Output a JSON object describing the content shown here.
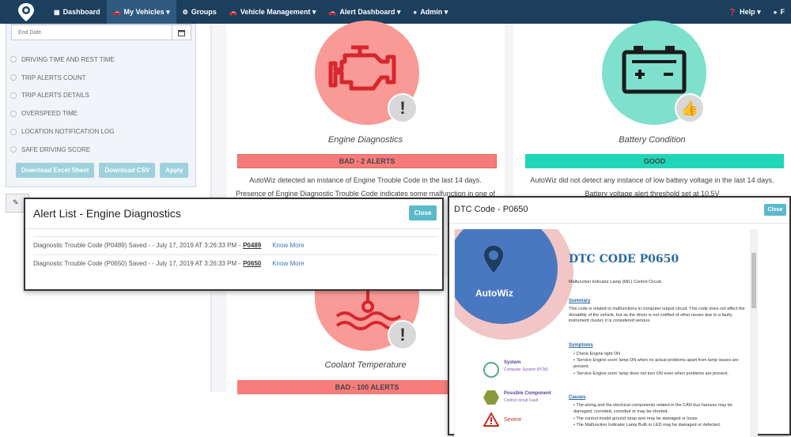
{
  "navbar": {
    "items": [
      {
        "label": "Dashboard",
        "icon": "dashboard-icon"
      },
      {
        "label": "My Vehicles",
        "icon": "car-icon"
      },
      {
        "label": "Groups",
        "icon": "gear-icon"
      },
      {
        "label": "Vehicle Management",
        "icon": "car-icon"
      },
      {
        "label": "Alert Dashboard",
        "icon": "car-icon"
      },
      {
        "label": "Admin",
        "icon": "user-icon"
      }
    ],
    "right": {
      "help": "Help",
      "user_initial": "F"
    },
    "colors": {
      "bg": "#1c3f5e",
      "active": "#2f5a80"
    }
  },
  "sidebar": {
    "end_date_placeholder": "End Date",
    "reports": [
      "DRIVING TIME AND REST TIME",
      "TRIP ALERTS COUNT",
      "TRIP ALERTS DETAILS",
      "OVERSPEED TIME",
      "LOCATION NOTIFICATION LOG",
      "SAFE DRIVING SCORE"
    ],
    "buttons": {
      "excel": "Download Excel Sheet",
      "csv": "Download CSV",
      "apply": "Apply"
    }
  },
  "cards": {
    "engine": {
      "title": "Engine Diagnostics",
      "status": "BAD - 2 ALERTS",
      "text1": "AutoWiz detected an instance of Engine Trouble Code in the last 14 days.",
      "text2": "Presence of Engine Diagnostic Trouble Code indicates some malfunction in one of",
      "color": "#f99a96",
      "status_color": "#f77b7b"
    },
    "battery": {
      "title": "Battery Condition",
      "status": "GOOD",
      "text1": "AutoWiz did not detect any instance of low battery voltage in the last 14 days.",
      "text2": "Battery voltage alert threshold set at 10.5V",
      "color": "#7ee0cd",
      "status_color": "#1fd6b8"
    },
    "coolant": {
      "title": "Coolant Temperature",
      "status": "BAD - 100 ALERTS",
      "color": "#f99a96",
      "status_color": "#f77b7b"
    }
  },
  "alert_modal": {
    "title": "Alert List - Engine Diagnostics",
    "close": "Close",
    "rows": [
      {
        "text": "Diagnostic Trouble Code (P0489) Saved - - July 17, 2019 AT 3:26:33 PM -",
        "code": "P0489",
        "link": "Know More"
      },
      {
        "text": "Diagnostic Trouble Code (P0650) Saved - - July 17, 2019 AT 3:26:33 PM -",
        "code": "P0650",
        "link": "Know More"
      }
    ]
  },
  "dtc_modal": {
    "title": "DTC Code - P0650",
    "close": "Close",
    "pdf": {
      "brand": "AutoWiz",
      "heading": "DTC CODE P0650",
      "subtitle": "Malfunction Indicator Lamp (MIL) Control Circuit.",
      "summary_h": "Summary",
      "summary": "This code is related to malfunctions in computer output circuit. This code does not affect the drivability of the vehicle, but as the driver is not notified of other issues due to a faulty instrument cluster, it is considered serious.",
      "symptoms_h": "Symptoms",
      "symptoms": [
        "Check Engine light ON",
        "'Service Engine soon' lamp ON when no actual problems apart from lamp issues are present.",
        "'Service Engine soon' lamp does not turn ON even when problems are present."
      ],
      "causes_h": "Causes",
      "causes": [
        "The wiring and the electrical components related in the CAN bus harness may be damaged, corroded, corroded or may be shorted.",
        "The control model ground strap wire may be damaged or loose.",
        "The Malfunction Indicator Lamp Bulb or LED may be damaged or defected."
      ],
      "system_label": "System",
      "system_value": "Computer System (PCM)",
      "component_label": "Possible Component",
      "component_value": "Control circuit Fault",
      "severity": "Severe"
    }
  }
}
